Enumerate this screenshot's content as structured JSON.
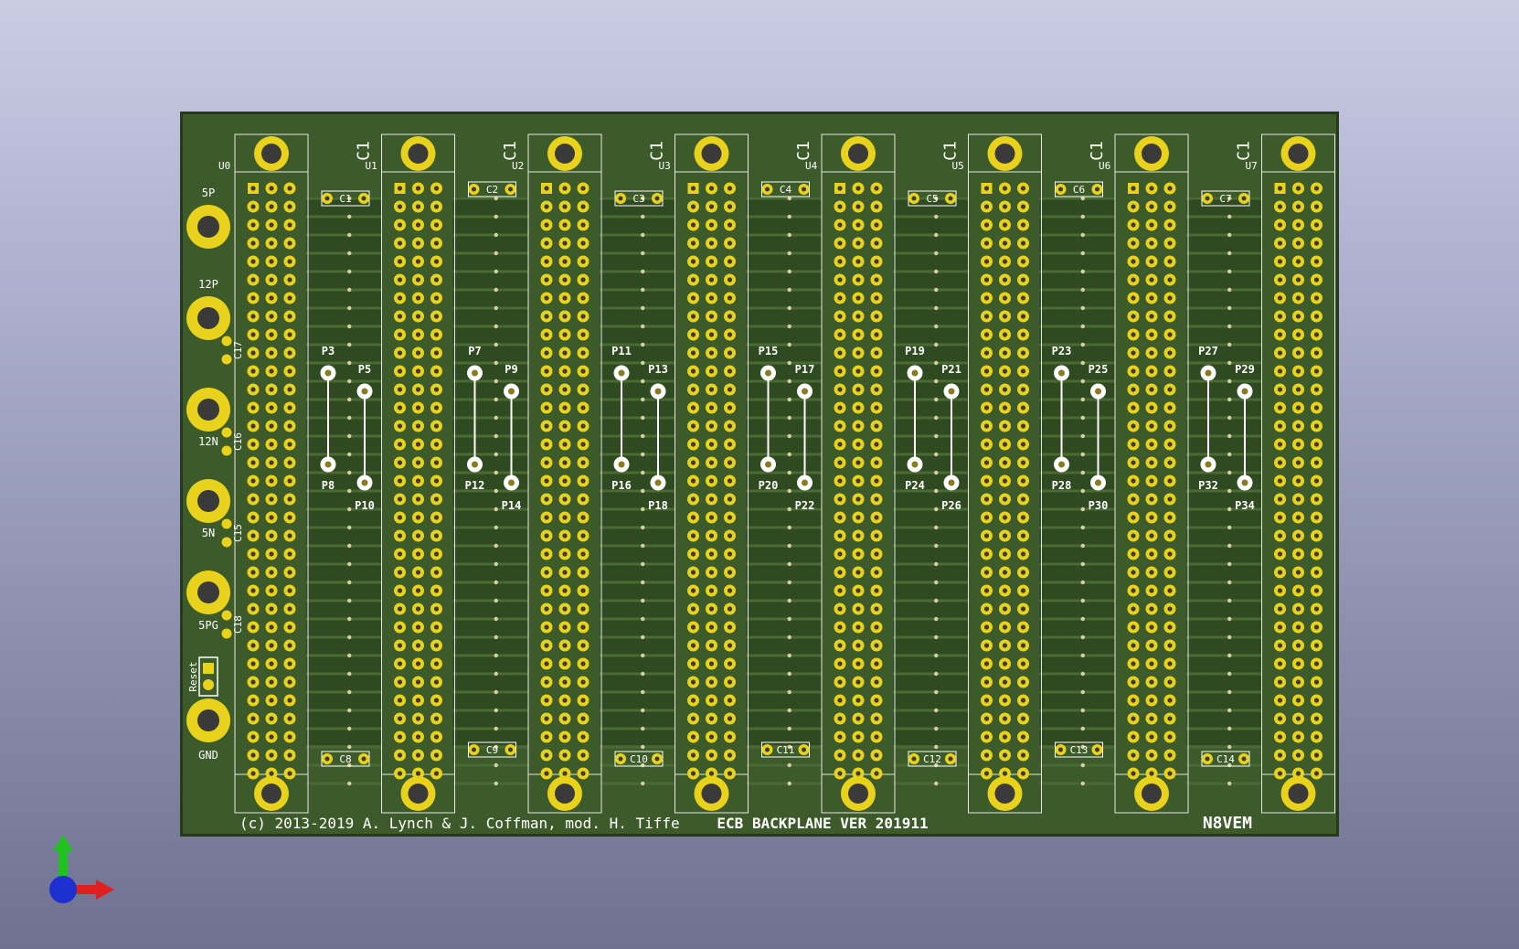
{
  "board": {
    "copyright": "(c) 2013-2019  A. Lynch & J. Coffman, mod. H. Tiffe",
    "title": "ECB BACKPLANE VER 201911",
    "brand": "N8VEM"
  },
  "colors": {
    "soldermask": "#3d5a2a",
    "pad_gold": "#e8d21c",
    "silkscreen": "#ffffff",
    "background_top": "#c9cce3",
    "background_bottom": "#6f7190"
  },
  "connectors": [
    "U0",
    "U1",
    "U2",
    "U3",
    "U4",
    "U5",
    "U6",
    "U7"
  ],
  "connector_caps": [
    "C1",
    "C1",
    "C1",
    "C1",
    "C1",
    "C1",
    "C1"
  ],
  "top_caps": [
    "C1",
    "C2",
    "C3",
    "C4",
    "C5",
    "C6",
    "C7"
  ],
  "bottom_caps": [
    "C8",
    "C9",
    "C10",
    "C11",
    "C12",
    "C13",
    "C14"
  ],
  "side_caps": [
    "C17",
    "C16",
    "C15",
    "C18"
  ],
  "power_terminals": [
    "5P",
    "12P",
    "12N",
    "5N",
    "5PG",
    "GND"
  ],
  "reset_label": "Reset",
  "jumpers": [
    [
      "P3",
      "P5",
      "P8",
      "P10"
    ],
    [
      "P7",
      "P9",
      "P12",
      "P14"
    ],
    [
      "P11",
      "P13",
      "P16",
      "P18"
    ],
    [
      "P15",
      "P17",
      "P20",
      "P22"
    ],
    [
      "P19",
      "P21",
      "P24",
      "P26"
    ],
    [
      "P23",
      "P25",
      "P28",
      "P30"
    ],
    [
      "P27",
      "P29",
      "P32",
      "P34"
    ]
  ],
  "axis_icons": [
    "y-axis-arrow-icon",
    "x-axis-arrow-icon",
    "z-axis-dot-icon"
  ]
}
